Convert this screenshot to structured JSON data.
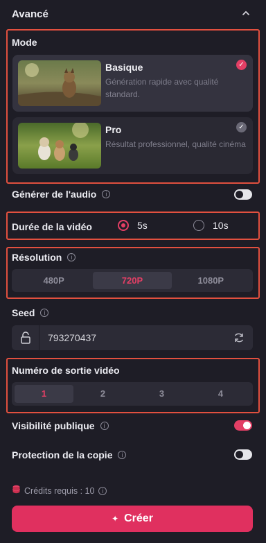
{
  "header": {
    "title": "Avancé",
    "collapse_icon": "chevron-up-icon"
  },
  "mode": {
    "label": "Mode",
    "options": [
      {
        "title": "Basique",
        "description": "Génération rapide avec qualité standard.",
        "selected": true
      },
      {
        "title": "Pro",
        "description": "Résultat professionnel, qualité cinéma",
        "selected": false
      }
    ]
  },
  "audio": {
    "label": "Générer de l'audio",
    "enabled": false
  },
  "duration": {
    "label": "Durée de la vidéo",
    "options": [
      "5s",
      "10s"
    ],
    "selected": "5s"
  },
  "resolution": {
    "label": "Résolution",
    "options": [
      "480P",
      "720P",
      "1080P"
    ],
    "selected": "720P"
  },
  "seed": {
    "label": "Seed",
    "value": "793270437"
  },
  "output": {
    "label": "Numéro de sortie vidéo",
    "options": [
      "1",
      "2",
      "3",
      "4"
    ],
    "selected": "1"
  },
  "visibility": {
    "label": "Visibilité publique",
    "enabled": true
  },
  "copy_protection": {
    "label": "Protection de la copie",
    "enabled": false
  },
  "credits": {
    "label": "Crédits requis : 10"
  },
  "create": {
    "label": "Créer"
  },
  "colors": {
    "accent": "#e33f65",
    "highlight": "#e2503f",
    "background": "#1e1d26"
  }
}
